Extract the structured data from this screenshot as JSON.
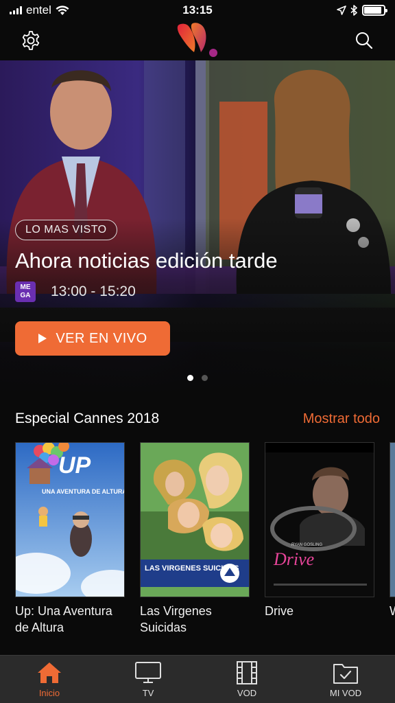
{
  "status_bar": {
    "carrier": "entel",
    "time": "13:15",
    "battery_level": 0.9
  },
  "header": {
    "settings_icon": "gear-icon",
    "search_icon": "search-icon",
    "logo_icon": "app-logo"
  },
  "hero": {
    "badge": "LO MAS VISTO",
    "title": "Ahora noticias edición tarde",
    "time_range": "13:00 - 15:20",
    "channel": "MEGA",
    "channel_line1": "ME",
    "channel_line2": "GA",
    "live_button_label": "VER EN VIVO",
    "page_count": 2,
    "active_page": 1
  },
  "section": {
    "title": "Especial Cannes 2018",
    "show_all_label": "Mostrar todo",
    "items": [
      {
        "title_line1": "Up: Una Aventura",
        "title_line2": "de Altura",
        "poster_title": "UP",
        "poster_subtitle": "UNA AVENTURA DE ALTURA"
      },
      {
        "title_line1": "Las Virgenes",
        "title_line2": "Suicidas",
        "poster_title": "LAS VIRGENES SUICIDAS",
        "poster_subtitle": ""
      },
      {
        "title_line1": "Drive",
        "title_line2": "",
        "poster_title": "Drive",
        "poster_subtitle": "RYAN GOSLING"
      },
      {
        "title_line1": "W",
        "title_line2": "",
        "poster_title": "",
        "poster_subtitle": ""
      }
    ]
  },
  "tab_bar": {
    "tabs": [
      {
        "label": "Inicio",
        "icon": "home-icon",
        "active": true
      },
      {
        "label": "TV",
        "icon": "tv-icon",
        "active": false
      },
      {
        "label": "VOD",
        "icon": "film-icon",
        "active": false
      },
      {
        "label": "MI VOD",
        "icon": "folder-check-icon",
        "active": false
      }
    ]
  },
  "colors": {
    "accent": "#ef6b35",
    "background": "#0a0a0a",
    "tab_bar": "#2b2b2b"
  }
}
